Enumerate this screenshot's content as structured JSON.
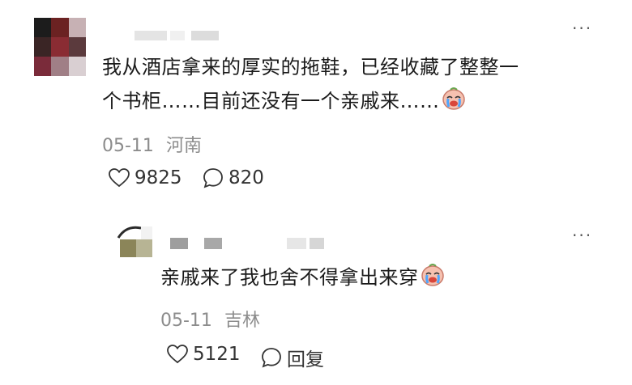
{
  "comment": {
    "text_line1": "我从酒店拿来的厚实的拖鞋，已经收藏了整整一",
    "text_line2": "个书柜……目前还没有一个亲戚来……",
    "emoji": "crying-face-emoji",
    "date": "05-11",
    "location": "河南",
    "likes": "9825",
    "replies": "820"
  },
  "reply": {
    "text": "亲戚来了我也舍不得拿出来穿",
    "emoji": "crying-face-emoji",
    "date": "05-11",
    "location": "吉林",
    "likes": "5121",
    "reply_label": "回复"
  },
  "more_label": "···"
}
